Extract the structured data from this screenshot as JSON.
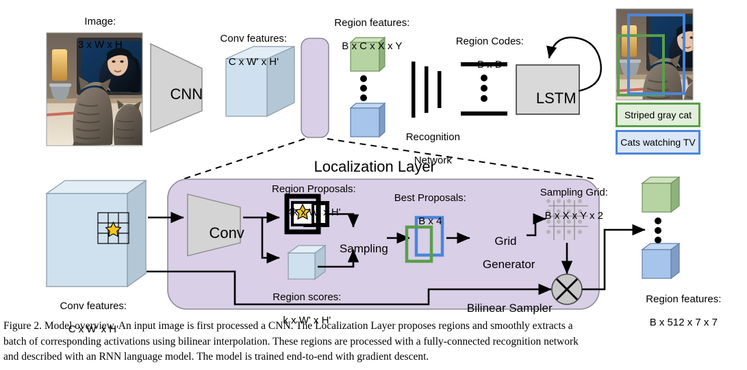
{
  "figure": {
    "number": "Figure 2.",
    "caption_lines": [
      "Figure 2. Model overview.  An input image is first processed a CNN. The Localization Layer proposes regions and smoothly extracts a",
      "batch of corresponding activations using bilinear interpolation.  These regions are processed with a fully-connected recognition network",
      "and described with an RNN language model. The model is trained end-to-end with gradient descent."
    ]
  },
  "top_pipeline": {
    "image_label_line1": "Image:",
    "image_label_line2": "3 x W x H",
    "cnn_label": "CNN",
    "conv_features_line1": "Conv features:",
    "conv_features_line2": "C x W' x H'",
    "region_features_line1": "Region features:",
    "region_features_line2": "B x C x X x Y",
    "recognition_network_line1": "Recognition",
    "recognition_network_line2": "Network",
    "region_codes_line1": "Region Codes:",
    "region_codes_line2": "B x D",
    "lstm_label": "LSTM"
  },
  "output_panel": {
    "tags": [
      {
        "text": "Striped gray cat",
        "color": "#5a9e4b",
        "fill": "#e2efdc"
      },
      {
        "text": "Cats watching TV",
        "color": "#4a86d8",
        "fill": "#dbe7f8"
      }
    ]
  },
  "localization_layer": {
    "title": "Localization Layer",
    "input_conv_features_line1": "Conv features:",
    "input_conv_features_line2": "C x W' x H'",
    "conv_label": "Conv",
    "region_proposals_line1": "Region Proposals:",
    "region_proposals_line2": "4k x W' x H'",
    "region_scores_line1": "Region scores:",
    "region_scores_line2": "k x W' x H'",
    "sampling_label": "Sampling",
    "best_proposals_line1": "Best Proposals:",
    "best_proposals_line2": "B x 4",
    "grid_generator_line1": "Grid",
    "grid_generator_line2": "Generator",
    "sampling_grid_line1": "Sampling Grid:",
    "sampling_grid_line2": "B x X x Y x 2",
    "bilinear_sampler_label": "Bilinear Sampler",
    "output_region_features_line1": "Region features:",
    "output_region_features_line2": "B x 512 x 7 x 7"
  },
  "colors": {
    "localization_fill": "#d9cfe6",
    "localization_stroke": "#777777",
    "cube_blue_front": "#cfe0ef",
    "cube_blue_top": "#e2edf6",
    "cube_blue_side": "#b3c7d6",
    "cube_green_front": "#b6d4a2",
    "cube_green_top": "#cde3bd",
    "cube_green_side": "#8fb27c",
    "cube_blue2_front": "#a7c5ea",
    "cube_blue2_top": "#c3d9f2",
    "cube_blue2_side": "#7f9dc4",
    "trapezoid_fill": "#d4d4d4",
    "lstm_fill": "#d9d9d9",
    "star_fill": "#f5c518",
    "grid_dot": "#b3b3b3",
    "bilinear_fill": "#c8c8c8",
    "box_green": "#5a9e4b",
    "box_blue": "#4a86d8"
  }
}
